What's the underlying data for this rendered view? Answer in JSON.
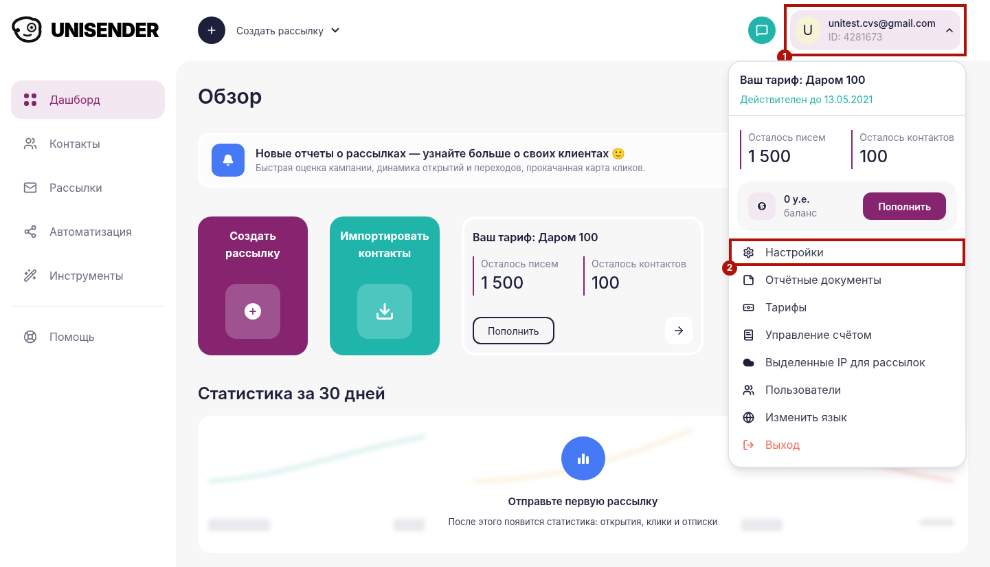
{
  "logo": {
    "text": "UNISENDER"
  },
  "header": {
    "create_label": "Создать рассылку",
    "user": {
      "initial": "U",
      "email": "unitest.cvs@gmail.com",
      "id": "ID: 4281673",
      "expanded": true,
      "annotation": "1"
    }
  },
  "sidebar": {
    "items": [
      {
        "label": "Дашборд",
        "kind": "dashboard",
        "selected": true
      },
      {
        "label": "Контакты",
        "kind": "contacts",
        "selected": false
      },
      {
        "label": "Рассылки",
        "kind": "mail",
        "selected": false
      },
      {
        "label": "Автоматизация",
        "kind": "automation",
        "selected": false
      },
      {
        "label": "Инструменты",
        "kind": "tools",
        "selected": false
      }
    ],
    "footer_items": [
      {
        "label": "Помощь",
        "kind": "help",
        "selected": false
      }
    ]
  },
  "main": {
    "title": "Обзор",
    "banner": {
      "title": "Новые отчеты о рассылках — узнайте больше о своих клиентах 🙂",
      "text": "Быстрая оценка кампании, динамика открытий и переходов, прокачанная карта кликов."
    },
    "actions": [
      {
        "label": "Создать рассылку",
        "kind": "create"
      },
      {
        "label": "Импортировать контакты",
        "kind": "import"
      }
    ],
    "tariff": {
      "title": "Ваш тариф: Даром 100",
      "stats": [
        {
          "label": "Осталось писем",
          "value": "1 500"
        },
        {
          "label": "Осталось контактов",
          "value": "100"
        }
      ],
      "button": "Пополнить"
    },
    "stats": {
      "title": "Статистика за 30 дней",
      "empty_title": "Отправьте первую рассылку",
      "empty_text": "После этого появится статистика: открытия, клики и отписки"
    }
  },
  "dropdown": {
    "title": "Ваш тариф: Даром 100",
    "valid": "Действителен до 13.05.2021",
    "stats": [
      {
        "label": "Осталось писем",
        "value": "1 500"
      },
      {
        "label": "Осталось контактов",
        "value": "100"
      }
    ],
    "balance": {
      "amount": "0 у.е.",
      "label": "баланс",
      "button": "Пополнить"
    },
    "items": [
      {
        "label": "Настройки",
        "kind": "settings",
        "annotation": "2"
      },
      {
        "label": "Отчётные документы",
        "kind": "document"
      },
      {
        "label": "Тарифы",
        "kind": "money"
      },
      {
        "label": "Управление счётом",
        "kind": "book"
      },
      {
        "label": "Выделенные IP для рассылок",
        "kind": "cloud"
      },
      {
        "label": "Пользователи",
        "kind": "users"
      },
      {
        "label": "Изменить язык",
        "kind": "globe"
      },
      {
        "label": "Выход",
        "kind": "logout"
      }
    ]
  }
}
